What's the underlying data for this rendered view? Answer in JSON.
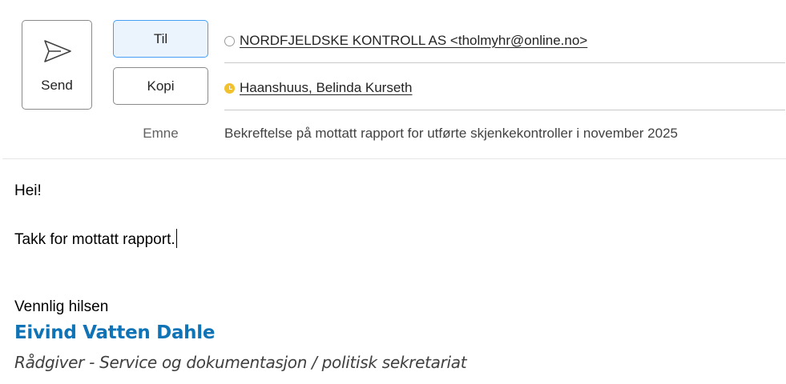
{
  "toolbar": {
    "send_label": "Send",
    "send_icon": "send-icon"
  },
  "fields": {
    "to_label": "Til",
    "cc_label": "Kopi",
    "subject_label": "Emne"
  },
  "recipients": {
    "to": [
      {
        "name": "NORDFJELDSKE KONTROLL AS <tholmyhr@online.no>",
        "presence": "offline"
      }
    ],
    "cc": [
      {
        "name": "Haanshuus, Belinda Kurseth",
        "presence": "away",
        "presence_color": "#f2c12e"
      }
    ]
  },
  "subject": "Bekreftelse på mottatt rapport for utførte skjenkekontroller i november 2025",
  "body": {
    "greeting": "Hei!",
    "message": "Takk for mottatt rapport.",
    "closing": "Vennlig hilsen"
  },
  "signature": {
    "name": "Eivind Vatten Dahle",
    "name_color": "#0f73b6",
    "title": "Rådgiver - Service og dokumentasjon / politisk sekretariat"
  },
  "colors": {
    "active_field_bg": "#ebf3fc",
    "active_field_border": "#479ef5"
  }
}
